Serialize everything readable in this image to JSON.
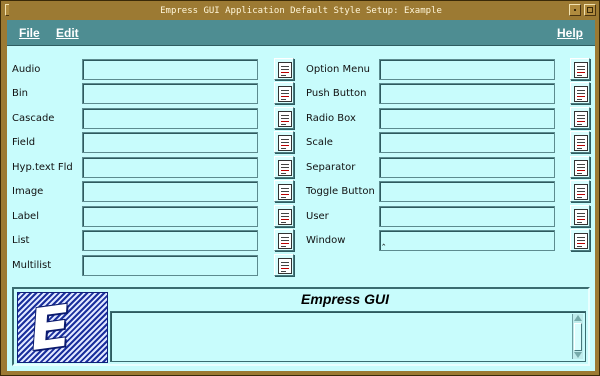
{
  "window": {
    "title": "Empress GUI Application Default Style Setup: Example"
  },
  "menu": {
    "file": "File",
    "edit": "Edit",
    "help": "Help"
  },
  "left_column": [
    {
      "label": "Audio",
      "value": ""
    },
    {
      "label": "Bin",
      "value": ""
    },
    {
      "label": "Cascade",
      "value": ""
    },
    {
      "label": "Field",
      "value": ""
    },
    {
      "label": "Hyp.text Fld",
      "value": ""
    },
    {
      "label": "Image",
      "value": ""
    },
    {
      "label": "Label",
      "value": ""
    },
    {
      "label": "List",
      "value": ""
    },
    {
      "label": "Multilist",
      "value": ""
    }
  ],
  "right_column": [
    {
      "label": "Option Menu",
      "value": ""
    },
    {
      "label": "Push Button",
      "value": ""
    },
    {
      "label": "Radio Box",
      "value": ""
    },
    {
      "label": "Scale",
      "value": ""
    },
    {
      "label": "Separator",
      "value": ""
    },
    {
      "label": "Toggle Button",
      "value": ""
    },
    {
      "label": "User",
      "value": ""
    },
    {
      "label": "Window",
      "value": ""
    }
  ],
  "bottom_panel": {
    "title": "Empress GUI",
    "message": ""
  },
  "icons": {
    "row_button": "style-sheet-icon",
    "logo": "empress-logo"
  },
  "colors": {
    "menubar": "#4e8d92",
    "client_bg": "#c8fcfc",
    "frame": "#9c7a33"
  }
}
